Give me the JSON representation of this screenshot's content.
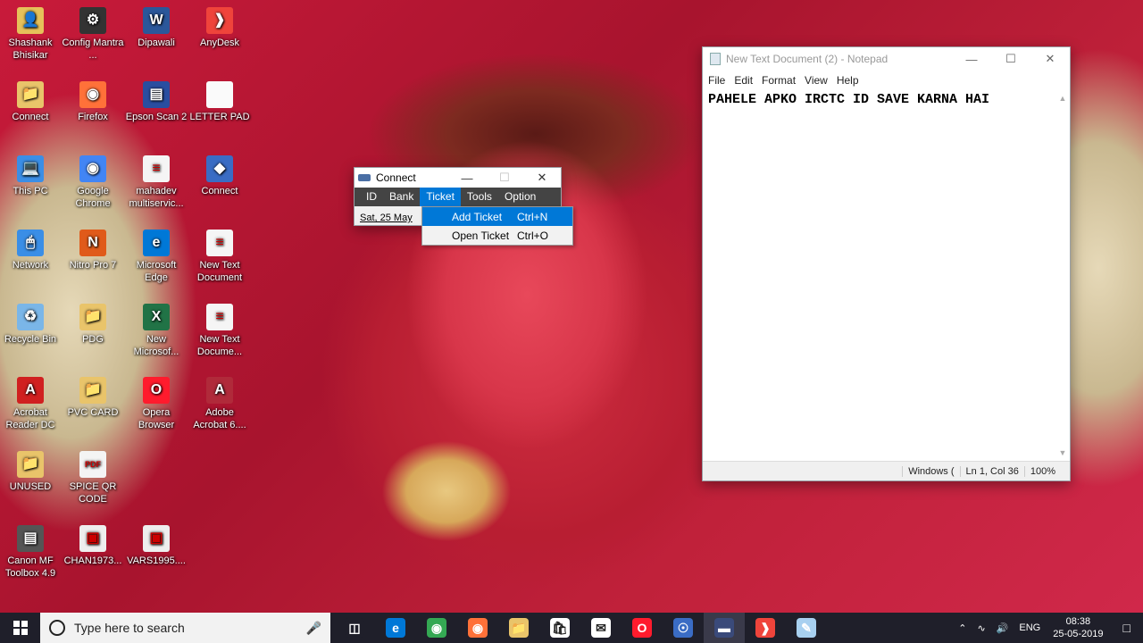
{
  "desktop_icons": [
    {
      "label": "Shashank Bhisikar",
      "icon": "user-folder-icon"
    },
    {
      "label": "Config Mantra ...",
      "icon": "shortcut-icon"
    },
    {
      "label": "Dipawali",
      "icon": "word-doc-icon"
    },
    {
      "label": "AnyDesk",
      "icon": "anydesk-icon"
    },
    {
      "label": "Connect",
      "icon": "folder-icon"
    },
    {
      "label": "Firefox",
      "icon": "firefox-icon"
    },
    {
      "label": "Epson Scan 2",
      "icon": "epson-scan-icon"
    },
    {
      "label": "LETTER PAD",
      "icon": "blank-doc-icon"
    },
    {
      "label": "This PC",
      "icon": "this-pc-icon"
    },
    {
      "label": "Google Chrome",
      "icon": "chrome-icon"
    },
    {
      "label": "mahadev multiservic...",
      "icon": "text-doc-icon"
    },
    {
      "label": "Connect",
      "icon": "connect-app-icon"
    },
    {
      "label": "Network",
      "icon": "network-icon"
    },
    {
      "label": "Nitro Pro 7",
      "icon": "nitro-icon"
    },
    {
      "label": "Microsoft Edge",
      "icon": "edge-icon"
    },
    {
      "label": "New Text Document",
      "icon": "text-doc-icon"
    },
    {
      "label": "Recycle Bin",
      "icon": "recycle-bin-icon"
    },
    {
      "label": "PDG",
      "icon": "folder-icon"
    },
    {
      "label": "New Microsof...",
      "icon": "excel-icon"
    },
    {
      "label": "New Text Docume...",
      "icon": "text-doc-icon"
    },
    {
      "label": "Acrobat Reader DC",
      "icon": "acrobat-icon"
    },
    {
      "label": "PVC CARD",
      "icon": "folder-icon"
    },
    {
      "label": "Opera Browser",
      "icon": "opera-icon"
    },
    {
      "label": "Adobe Acrobat 6....",
      "icon": "adobe-acrobat-icon"
    },
    {
      "label": "UNUSED",
      "icon": "folder-icon"
    },
    {
      "label": "SPICE QR CODE",
      "icon": "pdf-icon"
    },
    {
      "label": "Canon MF Toolbox 4.9",
      "icon": "canon-icon"
    },
    {
      "label": "CHAN1973...",
      "icon": "image-file-icon"
    },
    {
      "label": "VARS1995....",
      "icon": "image-file-icon"
    }
  ],
  "notepad": {
    "title": "New Text Document (2) - Notepad",
    "menu": [
      "File",
      "Edit",
      "Format",
      "View",
      "Help"
    ],
    "content": "PAHELE APKO IRCTC ID SAVE KARNA HAI",
    "status": {
      "encoding": "Windows (",
      "position": "Ln 1, Col 36",
      "zoom": "100%"
    }
  },
  "connect": {
    "title": "Connect",
    "menu": [
      "ID",
      "Bank",
      "Ticket",
      "Tools",
      "Option"
    ],
    "active_menu": "Ticket",
    "date": "Sat, 25 May",
    "dropdown": [
      {
        "label": "Add Ticket",
        "shortcut": "Ctrl+N"
      },
      {
        "label": "Open Ticket",
        "shortcut": "Ctrl+O"
      }
    ]
  },
  "taskbar": {
    "search_placeholder": "Type here to search",
    "apps": [
      "task-view-icon",
      "edge-icon",
      "chrome-icon",
      "firefox-icon",
      "file-explorer-icon",
      "store-icon",
      "mail-icon",
      "opera-icon",
      "security-icon",
      "connect-app-icon",
      "anydesk-icon",
      "notepad-icon"
    ],
    "language": "ENG",
    "time": "08:38",
    "date": "25-05-2019"
  },
  "colors": {
    "accent": "#0078d7",
    "taskbar": "#1f1f2a",
    "connect_menubar": "#444444"
  }
}
